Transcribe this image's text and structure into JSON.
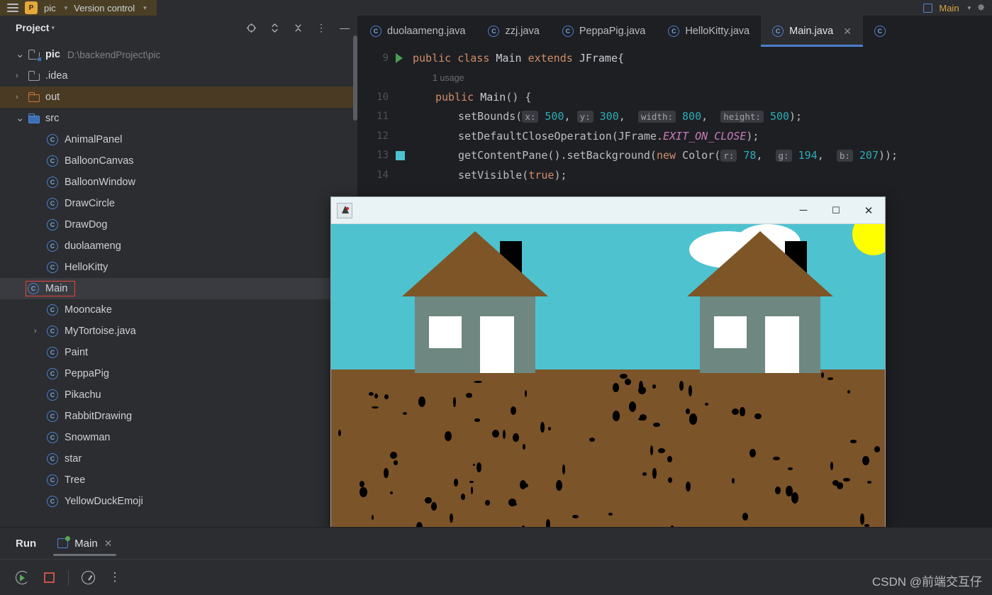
{
  "header": {
    "menu_icon": "hamburger-icon",
    "project_badge": "P",
    "project_name": "pic",
    "version_control": "Version control",
    "run_config": "Main",
    "loading_icon": "spinner-icon"
  },
  "sidebar": {
    "title": "Project",
    "actions": [
      {
        "name": "locate-file-icon",
        "glyph": "⊕"
      },
      {
        "name": "expand-collapse-icon",
        "glyph": "⇅"
      },
      {
        "name": "collapse-all-icon",
        "glyph": "✖"
      },
      {
        "name": "more-options-icon",
        "glyph": "⋮"
      },
      {
        "name": "hide-panel-icon",
        "glyph": "—"
      }
    ],
    "tree": [
      {
        "label": "pic",
        "path": "D:\\backendProject\\pic",
        "type": "module",
        "arrow": "down",
        "indent": 0,
        "bold": true
      },
      {
        "label": ".idea",
        "type": "folder",
        "arrow": "right",
        "indent": 1
      },
      {
        "label": "out",
        "type": "folder-orange",
        "arrow": "right",
        "indent": 1,
        "state": "highlighted"
      },
      {
        "label": "src",
        "type": "folder-blue",
        "arrow": "down",
        "indent": 1
      },
      {
        "label": "AnimalPanel",
        "type": "class",
        "indent": 2
      },
      {
        "label": "BalloonCanvas",
        "type": "class",
        "indent": 2
      },
      {
        "label": "BalloonWindow",
        "type": "class",
        "indent": 2
      },
      {
        "label": "DrawCircle",
        "type": "class",
        "indent": 2
      },
      {
        "label": "DrawDog",
        "type": "class",
        "indent": 2
      },
      {
        "label": "duolaameng",
        "type": "class",
        "indent": 2
      },
      {
        "label": "HelloKitty",
        "type": "class",
        "indent": 2
      },
      {
        "label": "Main",
        "type": "class",
        "indent": 2,
        "state": "selected-outlined"
      },
      {
        "label": "Mooncake",
        "type": "class",
        "indent": 2
      },
      {
        "label": "MyTortoise.java",
        "type": "class",
        "arrow": "right",
        "indent": 2
      },
      {
        "label": "Paint",
        "type": "class",
        "indent": 2
      },
      {
        "label": "PeppaPig",
        "type": "class",
        "indent": 2
      },
      {
        "label": "Pikachu",
        "type": "class",
        "indent": 2
      },
      {
        "label": "RabbitDrawing",
        "type": "class",
        "indent": 2
      },
      {
        "label": "Snowman",
        "type": "class",
        "indent": 2
      },
      {
        "label": "star",
        "type": "class",
        "indent": 2
      },
      {
        "label": "Tree",
        "type": "class",
        "indent": 2
      },
      {
        "label": "YellowDuckEmoji",
        "type": "class",
        "indent": 2
      }
    ]
  },
  "editor": {
    "tabs": [
      {
        "label": "duolaameng.java",
        "active": false,
        "closable": false
      },
      {
        "label": "zzj.java",
        "active": false,
        "closable": false
      },
      {
        "label": "PeppaPig.java",
        "active": false,
        "closable": false
      },
      {
        "label": "HelloKitty.java",
        "active": false,
        "closable": false
      },
      {
        "label": "Main.java",
        "active": true,
        "closable": true,
        "close_glyph": "✕"
      }
    ],
    "lines": [
      {
        "num": "9",
        "gutter": "run-arrow-icon",
        "segments": [
          {
            "t": "public ",
            "c": "kw"
          },
          {
            "t": "class ",
            "c": "kw"
          },
          {
            "t": "Main ",
            "c": "cls-n"
          },
          {
            "t": "extends ",
            "c": "kw"
          },
          {
            "t": "JFrame{",
            "c": "cls-n"
          }
        ]
      },
      {
        "num": "",
        "gutter": "",
        "inlay": "1 usage"
      },
      {
        "num": "10",
        "gutter": "",
        "indent": 1,
        "segments": [
          {
            "t": "public ",
            "c": "kw"
          },
          {
            "t": "Main",
            "c": "cls-n"
          },
          {
            "t": "() {",
            "c": "plain"
          }
        ]
      },
      {
        "num": "11",
        "gutter": "",
        "indent": 2,
        "segments": [
          {
            "t": "setBounds(",
            "c": "plain"
          },
          {
            "t": "x:",
            "c": "hint"
          },
          {
            "t": " ",
            "c": "plain"
          },
          {
            "t": "500",
            "c": "num"
          },
          {
            "t": ", ",
            "c": "plain"
          },
          {
            "t": "y:",
            "c": "hint"
          },
          {
            "t": " ",
            "c": "plain"
          },
          {
            "t": "300",
            "c": "num"
          },
          {
            "t": ",  ",
            "c": "plain"
          },
          {
            "t": "width:",
            "c": "hint"
          },
          {
            "t": " ",
            "c": "plain"
          },
          {
            "t": "800",
            "c": "num"
          },
          {
            "t": ",  ",
            "c": "plain"
          },
          {
            "t": "height:",
            "c": "hint"
          },
          {
            "t": " ",
            "c": "plain"
          },
          {
            "t": "500",
            "c": "num"
          },
          {
            "t": ");",
            "c": "plain"
          }
        ]
      },
      {
        "num": "12",
        "gutter": "",
        "indent": 2,
        "segments": [
          {
            "t": "setDefaultCloseOperation(JFrame.",
            "c": "plain"
          },
          {
            "t": "EXIT_ON_CLOSE",
            "c": "stat"
          },
          {
            "t": ");",
            "c": "plain"
          }
        ]
      },
      {
        "num": "13",
        "gutter": "color-swatch-icon",
        "indent": 2,
        "segments": [
          {
            "t": "getContentPane().setBackground(",
            "c": "plain"
          },
          {
            "t": "new ",
            "c": "kw"
          },
          {
            "t": "Color(",
            "c": "plain"
          },
          {
            "t": "r:",
            "c": "hint"
          },
          {
            "t": " ",
            "c": "plain"
          },
          {
            "t": "78",
            "c": "num"
          },
          {
            "t": ",  ",
            "c": "plain"
          },
          {
            "t": "g:",
            "c": "hint"
          },
          {
            "t": " ",
            "c": "plain"
          },
          {
            "t": "194",
            "c": "num"
          },
          {
            "t": ",  ",
            "c": "plain"
          },
          {
            "t": "b:",
            "c": "hint"
          },
          {
            "t": " ",
            "c": "plain"
          },
          {
            "t": "207",
            "c": "num"
          },
          {
            "t": "));",
            "c": "plain"
          }
        ]
      },
      {
        "num": "14",
        "gutter": "",
        "indent": 2,
        "segments": [
          {
            "t": "setVisible(",
            "c": "plain"
          },
          {
            "t": "true",
            "c": "kw"
          },
          {
            "t": ");",
            "c": "plain"
          }
        ]
      }
    ]
  },
  "swing_window": {
    "app_icon": "java-duke-icon",
    "title": "",
    "buttons": [
      {
        "name": "minimize-button",
        "glyph": "─"
      },
      {
        "name": "maximize-button",
        "glyph": "☐"
      },
      {
        "name": "close-button",
        "glyph": "✕"
      }
    ],
    "drawing": {
      "sky_color": "#4ec2cf",
      "ground_color": "#7c5429",
      "roof_color": "#7e5527",
      "house_body_color": "#6e8780",
      "window_color": "#ffffff",
      "chimney_color": "#000000",
      "sun_color": "#ffff00",
      "cloud_color": "#ffffff",
      "seed_color": "#000000"
    }
  },
  "run_panel": {
    "label": "Run",
    "tab": "Main",
    "tab_close": "✕",
    "toolbar": [
      {
        "name": "rerun-button",
        "glyph": "rerun-icon"
      },
      {
        "name": "stop-button",
        "glyph": "stop-icon"
      },
      {
        "name": "profiler-button",
        "glyph": "gauge-icon"
      },
      {
        "name": "more-options-button",
        "glyph": "⋮"
      }
    ]
  },
  "watermark": "CSDN @前端交互仔"
}
